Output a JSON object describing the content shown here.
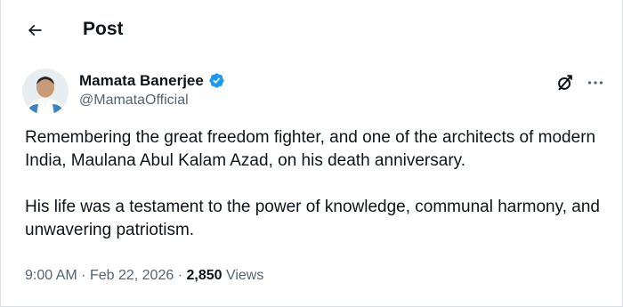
{
  "header": {
    "title": "Post",
    "back_icon": "arrow-left-icon"
  },
  "post": {
    "author": {
      "name": "Mamata Banerjee",
      "handle": "@MamataOfficial",
      "verified": true,
      "verified_icon": "verified-badge-icon"
    },
    "paragraphs": [
      "Remembering the great freedom fighter, and one of the architects of modern India, Maulana Abul Kalam Azad, on his death anniversary.",
      "His life was a testament to the power of knowledge, communal harmony, and unwavering patriotism."
    ],
    "time": "9:00 AM",
    "separator": "·",
    "date": "Feb 22, 2026",
    "views_count": "2,850",
    "views_label": "Views"
  },
  "actions": {
    "grok_icon": "grok-icon",
    "more_icon": "more-horizontal-icon"
  },
  "colors": {
    "text": "#0f1419",
    "secondary": "#536471",
    "verified": "#1d9bf0",
    "border": "#dcdfe3"
  }
}
